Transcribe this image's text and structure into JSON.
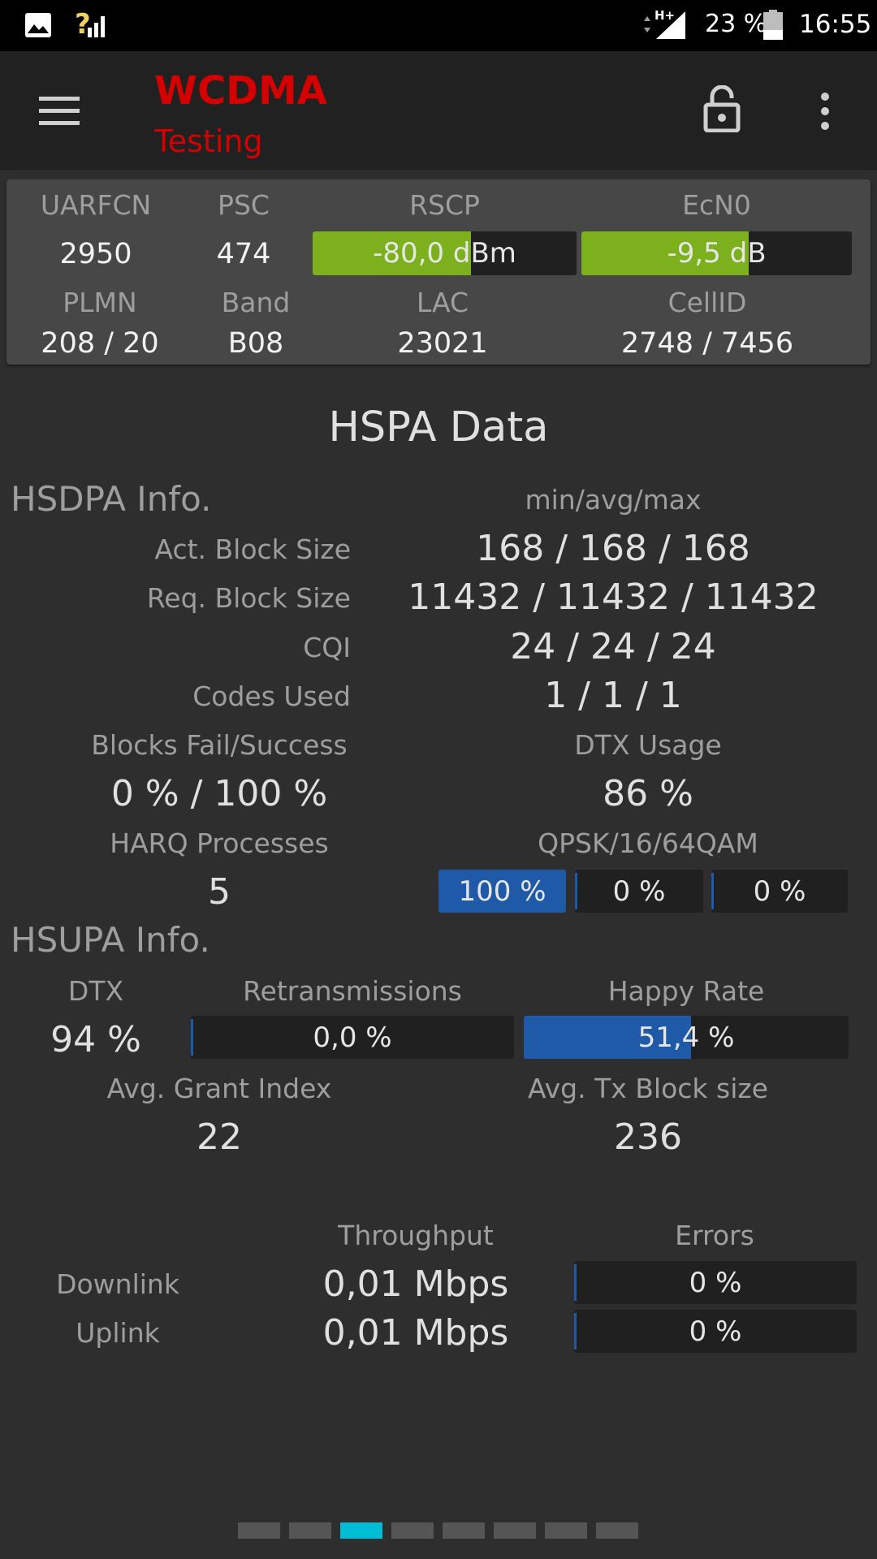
{
  "status_bar": {
    "signal_icon_text": "?",
    "network_badge": "H+",
    "battery": "23 %",
    "time": "16:55"
  },
  "app_bar": {
    "title": "WCDMA",
    "subtitle": "Testing",
    "title_color": "#d50000"
  },
  "cell": {
    "labels": {
      "uarfcn": "UARFCN",
      "psc": "PSC",
      "rscp": "RSCP",
      "ecn0": "EcN0",
      "plmn": "PLMN",
      "band": "Band",
      "lac": "LAC",
      "cellid": "CellID"
    },
    "uarfcn": "2950",
    "psc": "474",
    "rscp": {
      "text": "-80,0 dBm",
      "fill_fraction": 0.6
    },
    "ecn0": {
      "text": "-9,5 dB",
      "fill_fraction": 0.62
    },
    "plmn": "208 / 20",
    "band": "B08",
    "lac": "23021",
    "cellid": "2748 / 7456",
    "bar_color": "#7cb01c"
  },
  "page_title": "HSPA Data",
  "hsdpa": {
    "header": "HSDPA Info.",
    "stats_header": "min/avg/max",
    "rows": [
      {
        "label": "Act. Block Size",
        "value": "168 / 168 / 168"
      },
      {
        "label": "Req. Block Size",
        "value": "11432 / 11432 / 11432"
      },
      {
        "label": "CQI",
        "value": "24 / 24 / 24"
      },
      {
        "label": "Codes Used",
        "value": "1 / 1 / 1"
      }
    ],
    "blocks_label": "Blocks Fail/Success",
    "blocks_value": "0 % / 100 %",
    "dtx_label": "DTX Usage",
    "dtx_value": "86 %",
    "harq_label": "HARQ Processes",
    "harq_value": "5",
    "mod_label": "QPSK/16/64QAM",
    "modulation": [
      {
        "text": "100 %",
        "fill_fraction": 1.0
      },
      {
        "text": "0 %",
        "fill_fraction": 0.0
      },
      {
        "text": "0 %",
        "fill_fraction": 0.0
      }
    ],
    "bar_color": "#1e5aa8"
  },
  "hsupa": {
    "header": "HSUPA Info.",
    "dtx_label": "DTX",
    "dtx_value": "94 %",
    "retx_label": "Retransmissions",
    "retx": {
      "text": "0,0 %",
      "fill_fraction": 0.0
    },
    "happy_label": "Happy Rate",
    "happy": {
      "text": "51,4 %",
      "fill_fraction": 0.514
    },
    "grant_label": "Avg. Grant Index",
    "grant_value": "22",
    "txblock_label": "Avg. Tx Block size",
    "txblock_value": "236"
  },
  "throughput": {
    "throughput_header": "Throughput",
    "errors_header": "Errors",
    "rows": [
      {
        "label": "Downlink",
        "value": "0,01 Mbps",
        "errors": "0 %",
        "errors_fraction": 0.0
      },
      {
        "label": "Uplink",
        "value": "0,01 Mbps",
        "errors": "0 %",
        "errors_fraction": 0.0
      }
    ]
  },
  "pager": {
    "pages": 8,
    "active_index": 2,
    "active_color": "#00bcd4"
  }
}
